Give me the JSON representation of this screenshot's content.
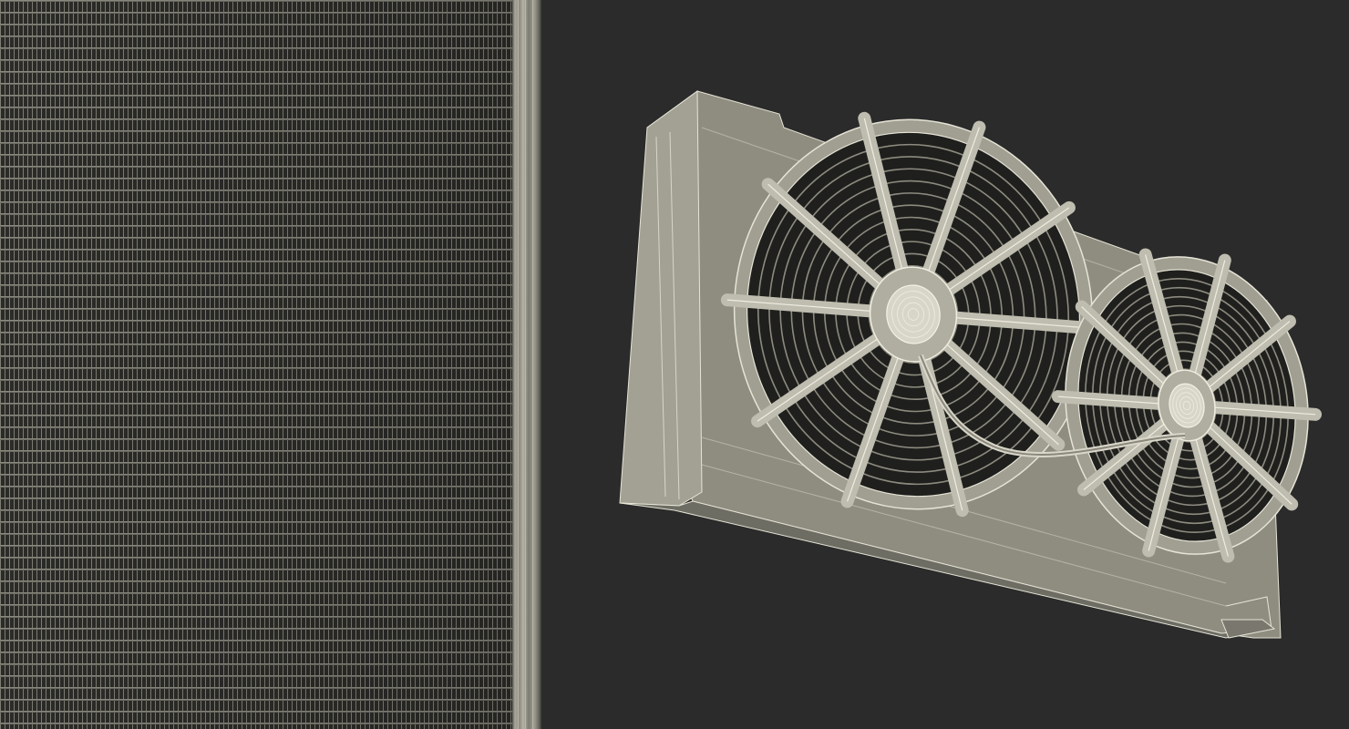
{
  "image": {
    "subject": "",
    "palette": {
      "background": "#2b2b2b",
      "mesh": "#a8a698",
      "mesh_light": "#e4e2d4",
      "shadow": "#1a1a18"
    },
    "fans": {
      "large": {
        "blades": 10
      },
      "small": {
        "blades": 10
      }
    }
  }
}
